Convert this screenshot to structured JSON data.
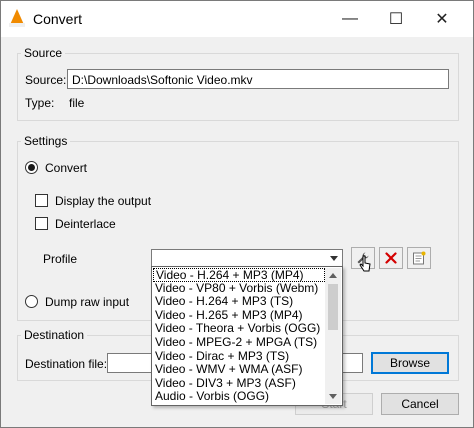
{
  "window": {
    "title": "Convert",
    "minimize_glyph": "—",
    "maximize_glyph": "☐",
    "close_glyph": "✕"
  },
  "source": {
    "legend": "Source",
    "source_label": "Source:",
    "source_value": "D:\\Downloads\\Softonic Video.mkv",
    "type_label": "Type:",
    "type_value": "file"
  },
  "settings": {
    "legend": "Settings",
    "convert_label": "Convert",
    "convert_selected": true,
    "display_output_label": "Display the output",
    "display_output_checked": false,
    "deinterlace_label": "Deinterlace",
    "deinterlace_checked": false,
    "profile_label": "Profile",
    "profile_value": "",
    "dump_raw_label": "Dump raw input",
    "dump_raw_selected": false
  },
  "profile_options": [
    "Video - H.264 + MP3 (MP4)",
    "Video - VP80 + Vorbis (Webm)",
    "Video - H.264 + MP3 (TS)",
    "Video - H.265 + MP3 (MP4)",
    "Video - Theora + Vorbis (OGG)",
    "Video - MPEG-2 + MPGA (TS)",
    "Video - Dirac + MP3 (TS)",
    "Video - WMV + WMA (ASF)",
    "Video - DIV3 + MP3 (ASF)",
    "Audio - Vorbis (OGG)"
  ],
  "destination": {
    "legend": "Destination",
    "file_label": "Destination file:",
    "file_value": "",
    "browse_label": "Browse"
  },
  "footer": {
    "start_label": "Start",
    "cancel_label": "Cancel"
  },
  "icons": {
    "edit_profile": "wrench-icon",
    "delete_profile": "red-x-icon",
    "new_profile": "new-profile-icon"
  },
  "colors": {
    "app_icon": "#f08a00",
    "delete_icon": "#d40000",
    "focus_border": "#0078d7"
  }
}
